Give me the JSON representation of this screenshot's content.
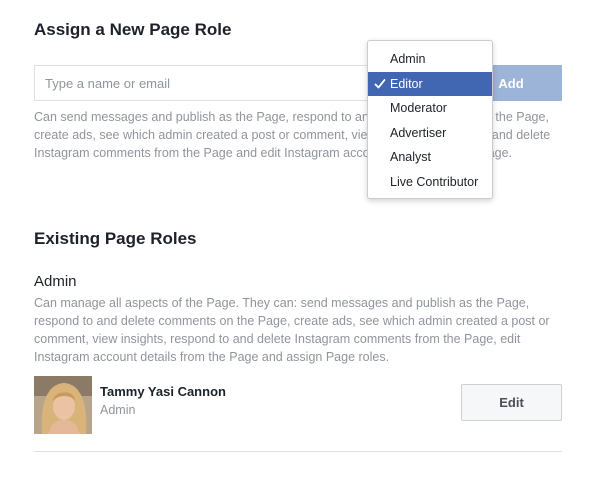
{
  "assign": {
    "title": "Assign a New Page Role",
    "input_placeholder": "Type a name or email",
    "add_label": "Add",
    "description": "Can send messages and publish as the Page, respond to and delete comments on the Page, create ads, see which admin created a post or comment, view insights, respond to and delete Instagram comments from the Page and edit Instagram account details from the Page."
  },
  "role_dropdown": {
    "selected": "Editor",
    "options": [
      "Admin",
      "Editor",
      "Moderator",
      "Advertiser",
      "Analyst",
      "Live Contributor"
    ]
  },
  "existing": {
    "title": "Existing Page Roles",
    "role_heading": "Admin",
    "role_description": "Can manage all aspects of the Page. They can: send messages and publish as the Page, respond to and delete comments on the Page, create ads, see which admin created a post or comment, view insights, respond to and delete Instagram comments from the Page, edit Instagram account details from the Page and assign Page roles.",
    "user": {
      "name": "Tammy Yasi Cannon",
      "role": "Admin",
      "edit_label": "Edit"
    }
  },
  "colors": {
    "add_button": "#9cb4d8",
    "selected_option": "#4267b2",
    "muted_text": "#90949c"
  }
}
